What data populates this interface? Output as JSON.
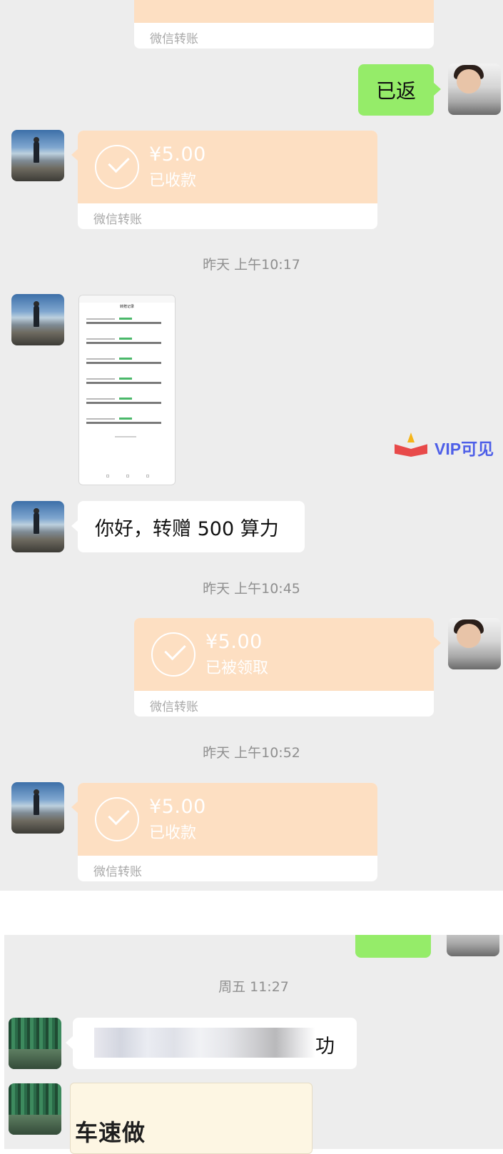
{
  "panel_top": {
    "partial_transfer_label": "微信转账",
    "reply_bubble": "已返",
    "transfer_1": {
      "amount": "¥5.00",
      "status": "已收款",
      "label": "微信转账"
    },
    "timestamp_1": "昨天 上午10:17",
    "screenshot_thumb": {
      "title": "转赠记录",
      "row_count": 6
    },
    "watermark": {
      "text": "VIP可见",
      "icon": "open-book-logo"
    },
    "message_1": "你好，转赠 500 算力",
    "timestamp_2": "昨天 上午10:45",
    "transfer_2": {
      "amount": "¥5.00",
      "status": "已被领取",
      "label": "微信转账"
    },
    "timestamp_3": "昨天 上午10:52",
    "transfer_3": {
      "amount": "¥5.00",
      "status": "已收款",
      "label": "微信转账"
    }
  },
  "panel_bottom": {
    "timestamp": "周五 11:27",
    "blurred_message_visible_tail": "功",
    "card_visible_text": "车速做"
  },
  "colors": {
    "chat_background": "#ededed",
    "transfer_orange": "#fddfc2",
    "sent_green": "#95ec69",
    "timestamp_gray": "#8f8f8f",
    "watermark_blue": "#4e5fe8",
    "watermark_red": "#e84a4a"
  }
}
